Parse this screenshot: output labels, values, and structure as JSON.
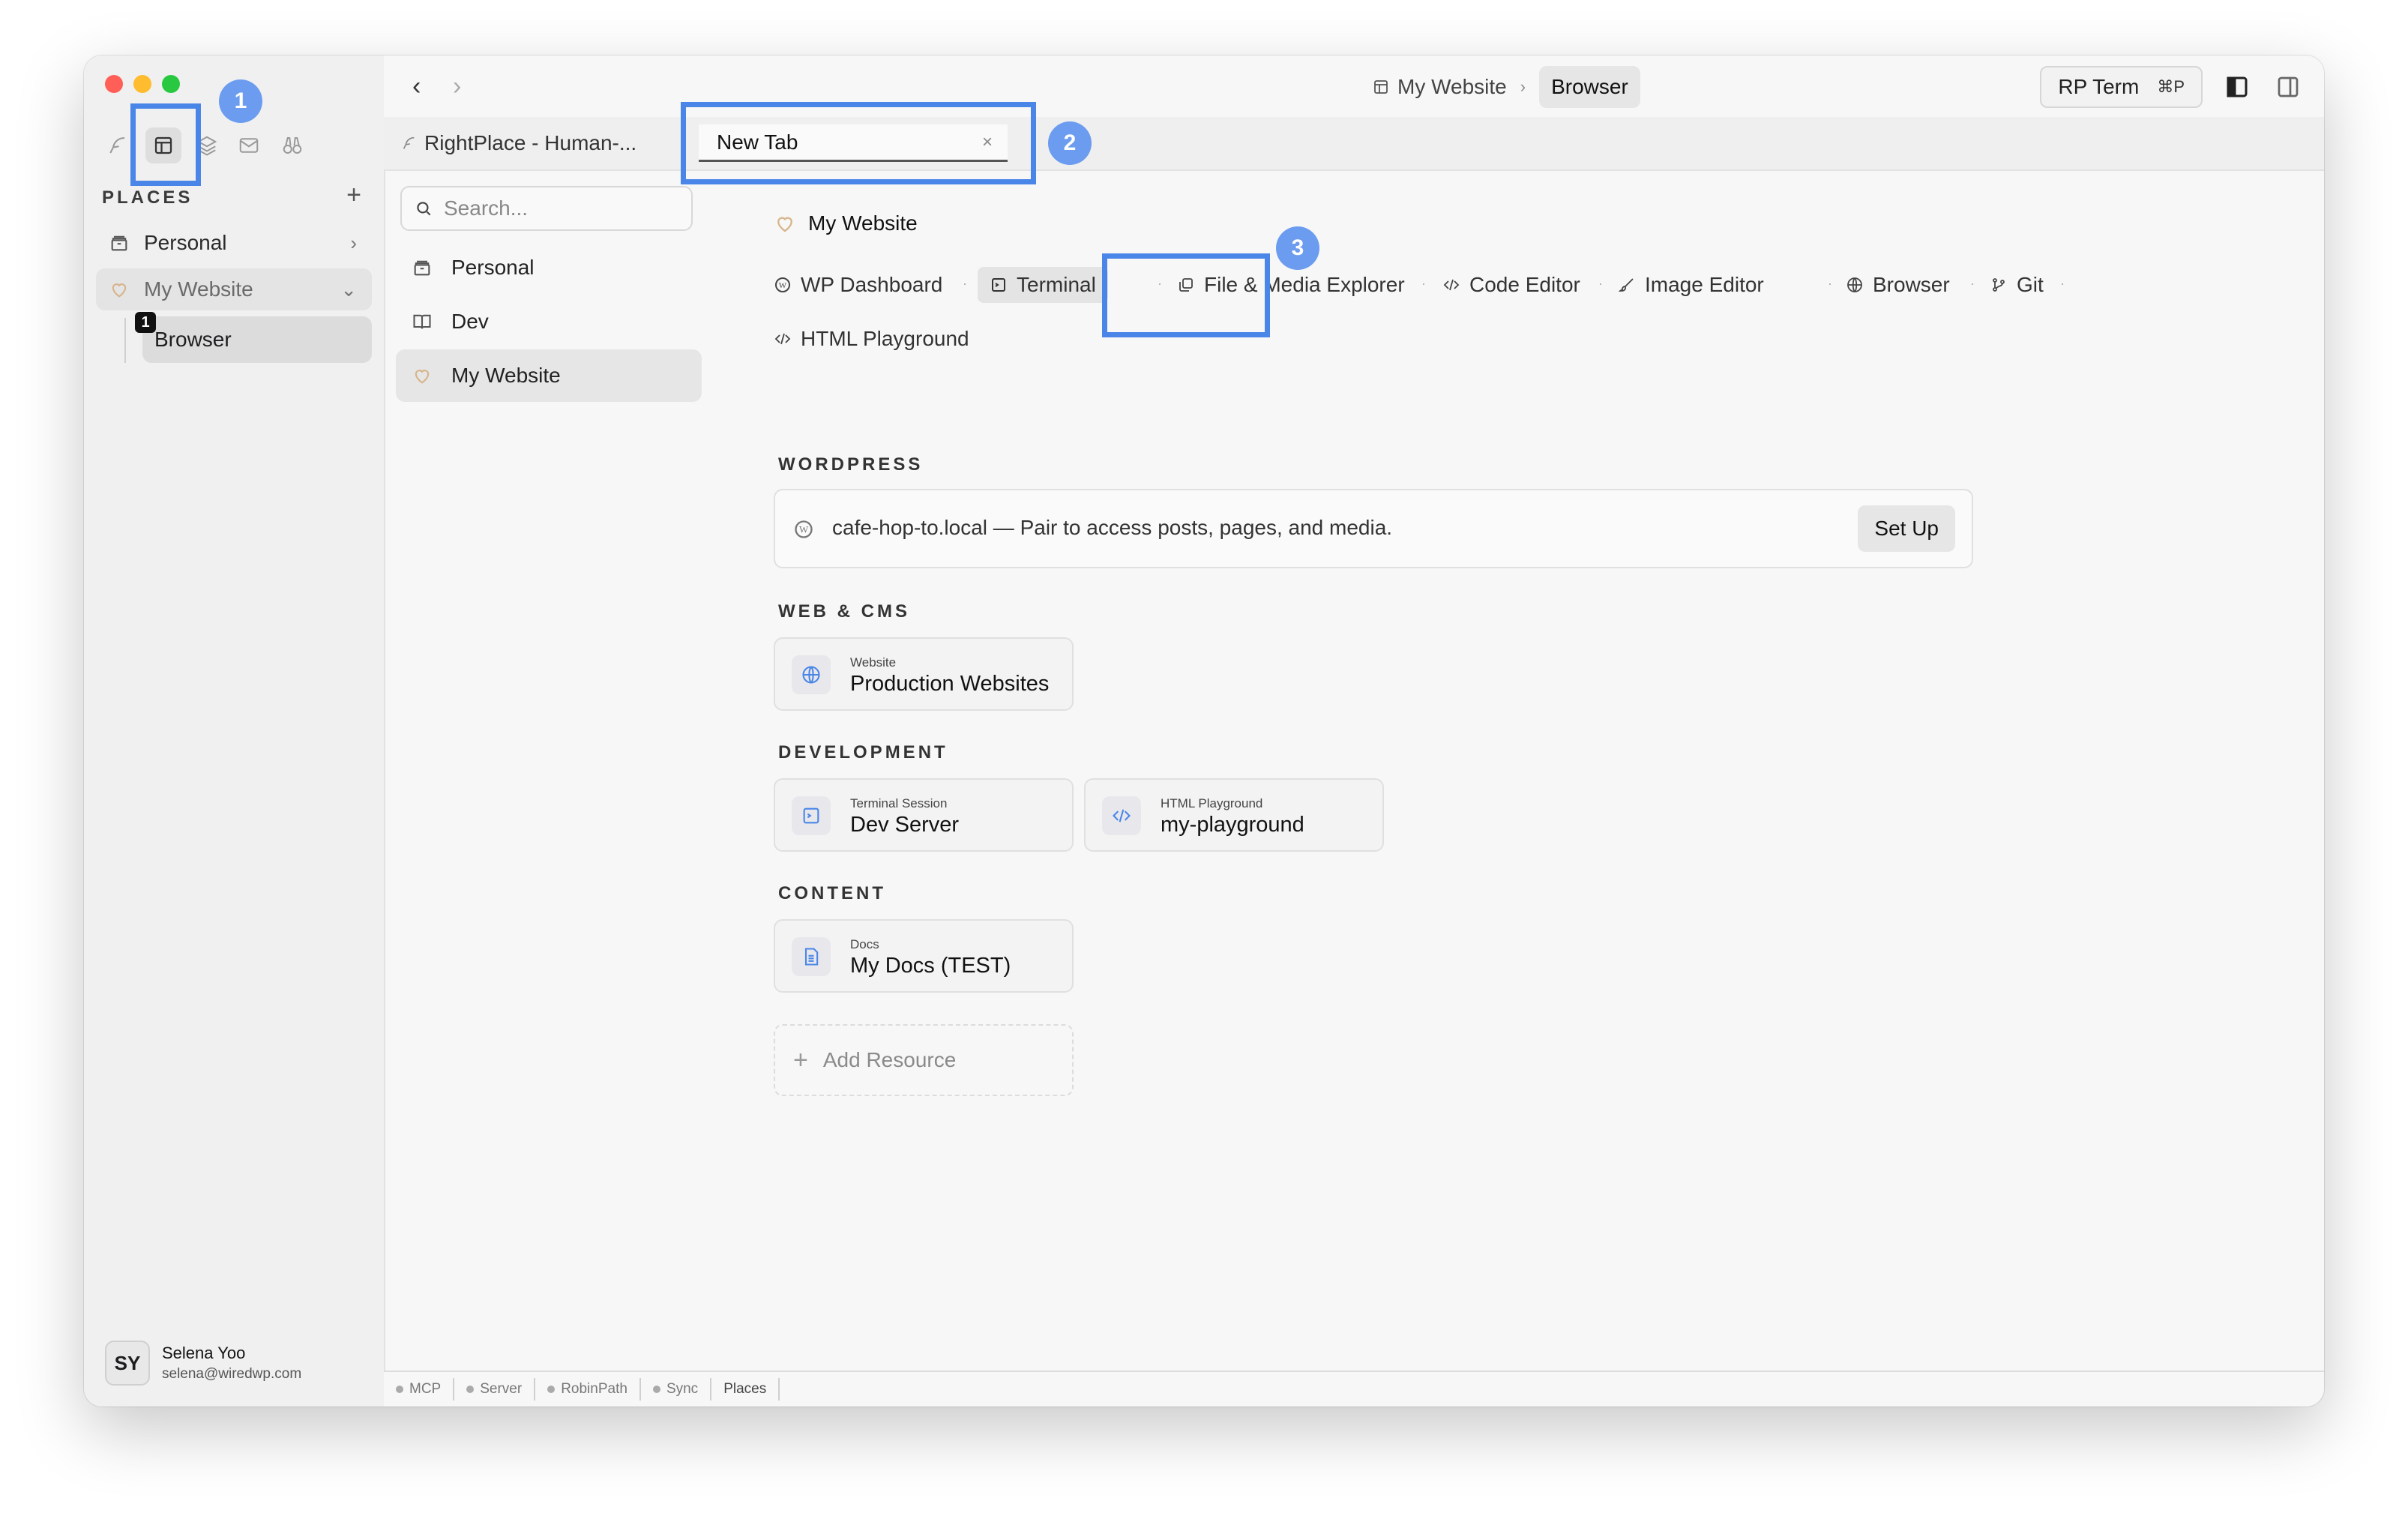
{
  "sidebar": {
    "places_header": "PLACES",
    "places_add": "+",
    "items": [
      {
        "label": "Personal",
        "chevron": "›"
      },
      {
        "label": "My Website",
        "chevron": "⌄"
      }
    ],
    "child": {
      "label": "Browser",
      "badge": "1"
    },
    "user": {
      "initials": "SY",
      "name": "Selena Yoo",
      "email": "selena@wiredwp.com"
    }
  },
  "topbar": {
    "back": "‹",
    "forward": "›",
    "breadcrumb": {
      "parent": "My Website",
      "separator": "›",
      "current": "Browser"
    },
    "rp_term": {
      "label": "RP Term",
      "shortcut": "⌘P"
    }
  },
  "tabs": [
    {
      "label": "RightPlace - Human-..."
    },
    {
      "label": "New Tab",
      "close": "×"
    }
  ],
  "annotations": [
    "1",
    "2",
    "3"
  ],
  "middle": {
    "search_placeholder": "Search...",
    "items": [
      {
        "label": "Personal"
      },
      {
        "label": "Dev"
      },
      {
        "label": "My Website"
      }
    ]
  },
  "main": {
    "title": "My Website",
    "tools": [
      {
        "label": "WP Dashboard",
        "icon": "wordpress-icon"
      },
      {
        "label": "Terminal",
        "icon": "terminal-icon"
      },
      {
        "label": "File & Media Explorer",
        "icon": "files-icon"
      },
      {
        "label": "Code Editor",
        "icon": "code-icon"
      },
      {
        "label": "Image Editor",
        "icon": "brush-icon"
      },
      {
        "label": "Browser",
        "icon": "globe-icon"
      },
      {
        "label": "Git",
        "icon": "git-icon"
      },
      {
        "label": "HTML Playground",
        "icon": "code-icon"
      }
    ],
    "sections": {
      "wordpress": "WORDPRESS",
      "web_cms": "WEB & CMS",
      "development": "DEVELOPMENT",
      "content": "CONTENT"
    },
    "wordpress_row": {
      "text": "cafe-hop-to.local — Pair to access posts, pages, and media.",
      "button": "Set Up"
    },
    "cards": {
      "website": {
        "label": "Website",
        "value": "Production Websites"
      },
      "terminal": {
        "label": "Terminal Session",
        "value": "Dev Server"
      },
      "playground": {
        "label": "HTML Playground",
        "value": "my-playground"
      },
      "docs": {
        "label": "Docs",
        "value": "My Docs (TEST)"
      }
    },
    "add_resource": {
      "plus": "+",
      "label": "Add Resource"
    }
  },
  "statusbar": [
    "MCP",
    "Server",
    "RobinPath",
    "Sync",
    "Places"
  ],
  "colors": {
    "highlight": "#4a86e8",
    "badge": "#6b9cf0",
    "close": "#ff5f57",
    "minimize": "#febc2e",
    "zoom": "#28c840"
  }
}
